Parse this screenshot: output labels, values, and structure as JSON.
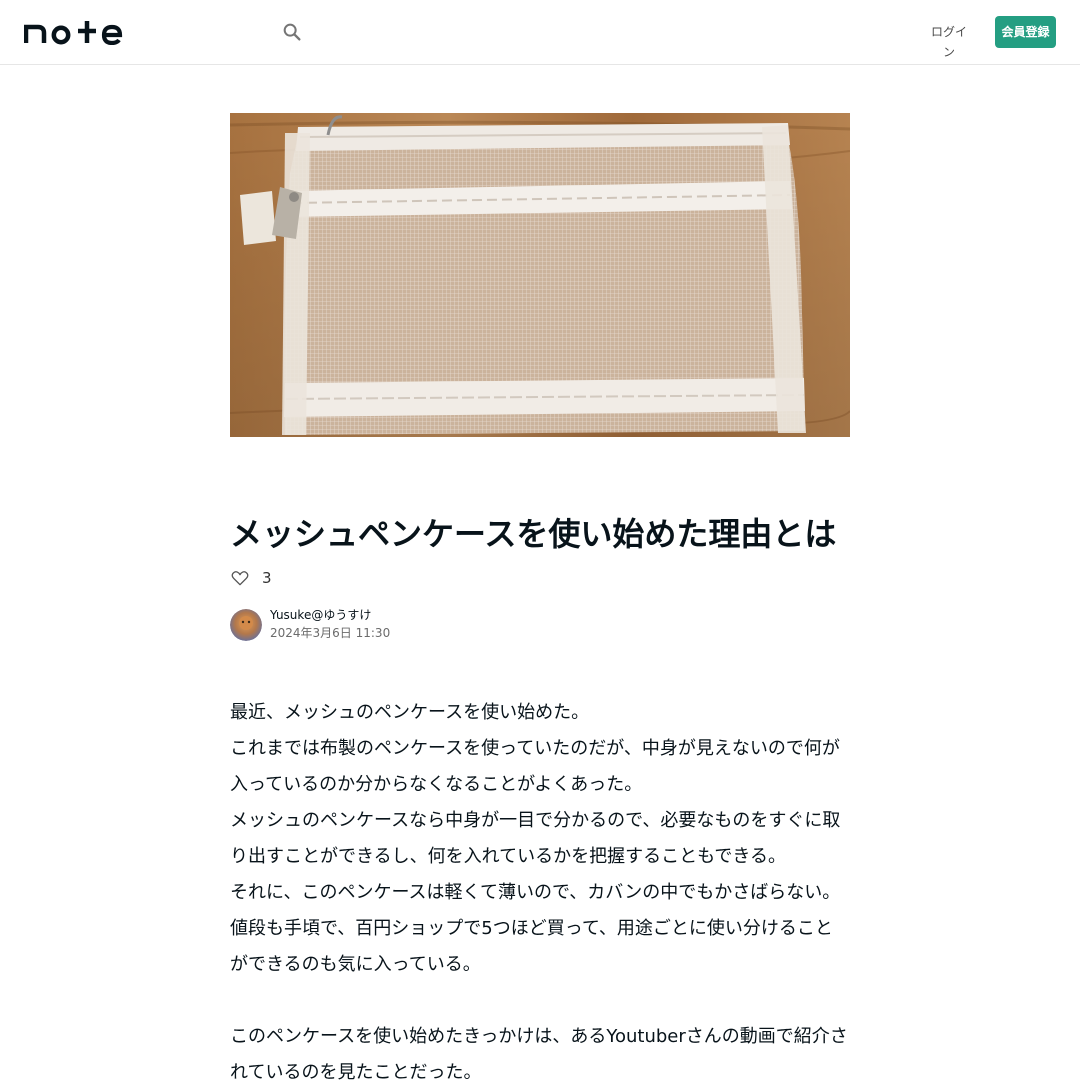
{
  "header": {
    "login_label": "ログイン",
    "signup_label": "会員登録"
  },
  "article": {
    "title": "メッシュペンケースを使い始めた理由とは",
    "like_count": "3",
    "author_name": "Yusuke@ゆうすけ",
    "date": "2024年3月6日 11:30",
    "paragraphs": [
      "最近、メッシュのペンケースを使い始めた。",
      "これまでは布製のペンケースを使っていたのだが、中身が見えないので何が入っているのか分からなくなることがよくあった。",
      "メッシュのペンケースなら中身が一目で分かるので、必要なものをすぐに取り出すことができるし、何を入れているかを把握することもできる。",
      "それに、このペンケースは軽くて薄いので、カバンの中でもかさばらない。",
      "値段も手頃で、百円ショップで5つほど買って、用途ごとに使い分けることができるのも気に入っている。",
      "",
      "このペンケースを使い始めたきっかけは、あるYoutuberさんの動画で紹介されているのを見たことだった。"
    ]
  },
  "colors": {
    "brand_green": "#249e82",
    "text": "#08131a"
  },
  "icons": {
    "search": "search-icon",
    "like": "heart-icon"
  }
}
